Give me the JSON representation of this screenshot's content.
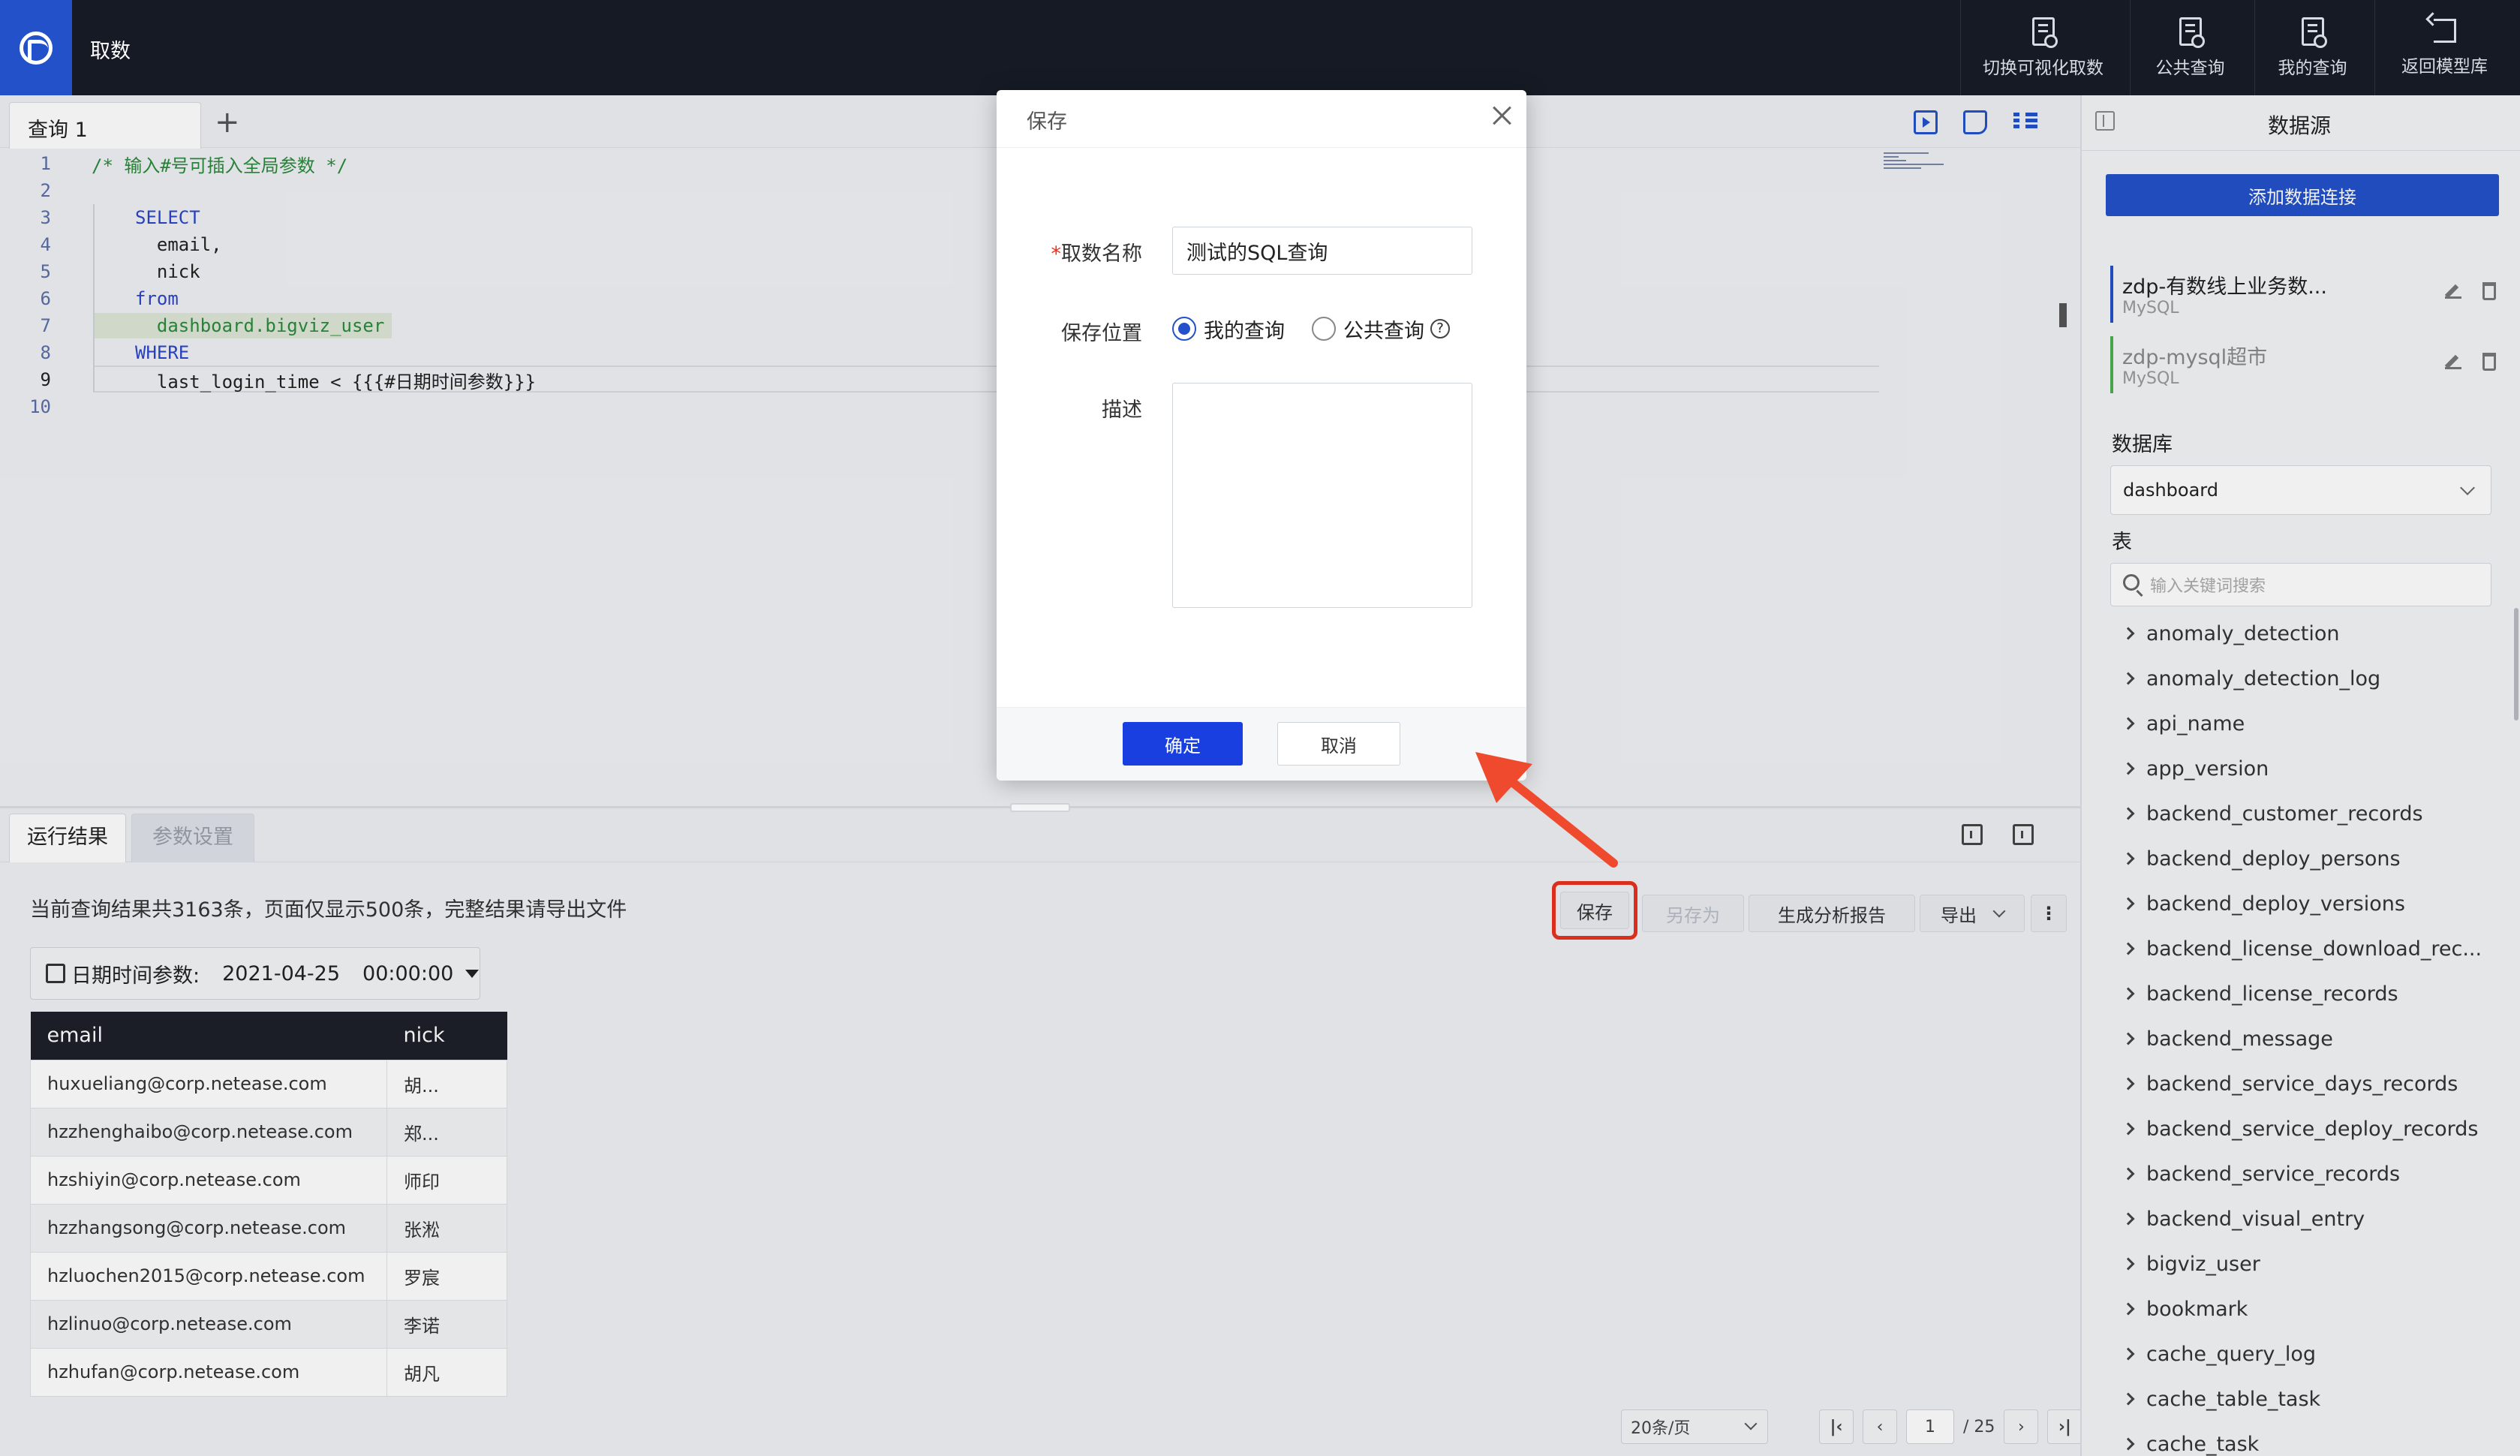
{
  "app": {
    "title": "取数"
  },
  "header": {
    "buttons": [
      {
        "label": "切换可视化取数",
        "icon": "doc-search-icon"
      },
      {
        "label": "公共查询",
        "icon": "doc-search-icon"
      },
      {
        "label": "我的查询",
        "icon": "doc-search-icon"
      },
      {
        "label": "返回模型库",
        "icon": "back-icon"
      }
    ]
  },
  "editor": {
    "tabs": [
      {
        "label": "查询 1"
      }
    ],
    "add_tab": "+",
    "lines": [
      {
        "n": "1",
        "text": "/* 输入#号可插入全局参数 */"
      },
      {
        "n": "2",
        "text": ""
      },
      {
        "n": "3",
        "text": "SELECT"
      },
      {
        "n": "4",
        "text": "  email,"
      },
      {
        "n": "5",
        "text": "  nick"
      },
      {
        "n": "6",
        "text": "from"
      },
      {
        "n": "7",
        "text": "  dashboard.bigviz_user"
      },
      {
        "n": "8",
        "text": "WHERE"
      },
      {
        "n": "9",
        "text": "  last_login_time < {{{#日期时间参数}}}"
      },
      {
        "n": "10",
        "text": ""
      }
    ]
  },
  "results": {
    "tabs": [
      {
        "label": "运行结果"
      },
      {
        "label": "参数设置"
      }
    ],
    "summary": "当前查询结果共3163条，页面仅显示500条，完整结果请导出文件",
    "buttons": {
      "save": "保存",
      "save_as": "另存为",
      "report": "生成分析报告",
      "export": "导出",
      "more": "⋮"
    },
    "date_param": {
      "label": "日期时间参数:",
      "date": "2021-04-25",
      "time": "00:00:00"
    },
    "table": {
      "headers": [
        "email",
        "nick"
      ],
      "rows": [
        [
          "huxueliang@corp.netease.com",
          "胡..."
        ],
        [
          "hzzhenghaibo@corp.netease.com",
          "郑..."
        ],
        [
          "hzshiyin@corp.netease.com",
          "师印"
        ],
        [
          "hzzhangsong@corp.netease.com",
          "张淞"
        ],
        [
          "hzluochen2015@corp.netease.com",
          "罗宸"
        ],
        [
          "hzlinuo@corp.netease.com",
          "李诺"
        ],
        [
          "hzhufan@corp.netease.com",
          "胡凡"
        ]
      ]
    },
    "pager": {
      "page_size": "20条/页",
      "current": "1",
      "total": "/ 25"
    }
  },
  "sidebar": {
    "title": "数据源",
    "add_connection": "添加数据连接",
    "connections": [
      {
        "name": "zdp-有数线上业务数...",
        "type": "MySQL",
        "color": "#2251c9"
      },
      {
        "name": "zdp-mysql超市",
        "type": "MySQL",
        "color": "#4caf50"
      }
    ],
    "db_label": "数据库",
    "db_value": "dashboard",
    "table_label": "表",
    "search_placeholder": "输入关键词搜索",
    "tables": [
      "anomaly_detection",
      "anomaly_detection_log",
      "api_name",
      "app_version",
      "backend_customer_records",
      "backend_deploy_persons",
      "backend_deploy_versions",
      "backend_license_download_rec...",
      "backend_license_records",
      "backend_message",
      "backend_service_days_records",
      "backend_service_deploy_records",
      "backend_service_records",
      "backend_visual_entry",
      "bigviz_user",
      "bookmark",
      "cache_query_log",
      "cache_table_task",
      "cache_task"
    ]
  },
  "modal": {
    "title": "保存",
    "name_label": "取数名称",
    "name_required": "*",
    "name_value": "测试的SQL查询",
    "location_label": "保存位置",
    "option_mine": "我的查询",
    "option_public": "公共查询",
    "help": "?",
    "desc_label": "描述",
    "ok": "确定",
    "cancel": "取消"
  },
  "colors": {
    "brand": "#2251c9",
    "accent_red": "#e8321f",
    "header_bg": "#151a24"
  }
}
